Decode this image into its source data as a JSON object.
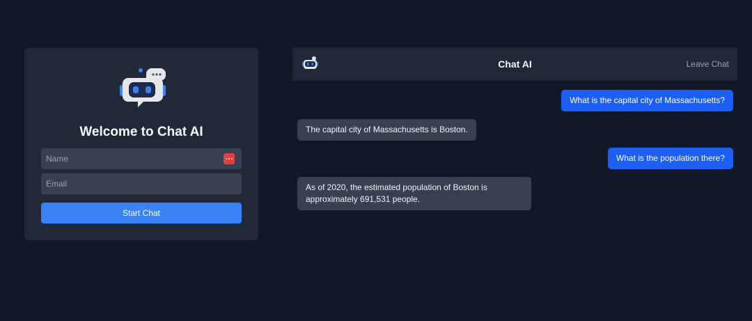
{
  "login": {
    "title": "Welcome to Chat AI",
    "name_placeholder": "Name",
    "email_placeholder": "Email",
    "start_button": "Start Chat"
  },
  "header": {
    "title": "Chat AI",
    "leave_button": "Leave Chat"
  },
  "messages": [
    {
      "role": "user",
      "text": "What is the capital city of Massachusetts?"
    },
    {
      "role": "bot",
      "text": "The capital city of Massachusetts is Boston."
    },
    {
      "role": "user",
      "text": "What is the population there?"
    },
    {
      "role": "bot",
      "text": "As of 2020, the estimated population of Boston is approximately 691,531 people."
    }
  ],
  "colors": {
    "background": "#111827",
    "panel": "#1f2937",
    "input": "#374151",
    "accent": "#3b82f6",
    "user_bubble": "#1d5ef5",
    "password_badge": "#e53e3e"
  },
  "icons": {
    "logo": "robot-chat-icon",
    "password_manager": "password-manager-icon"
  }
}
